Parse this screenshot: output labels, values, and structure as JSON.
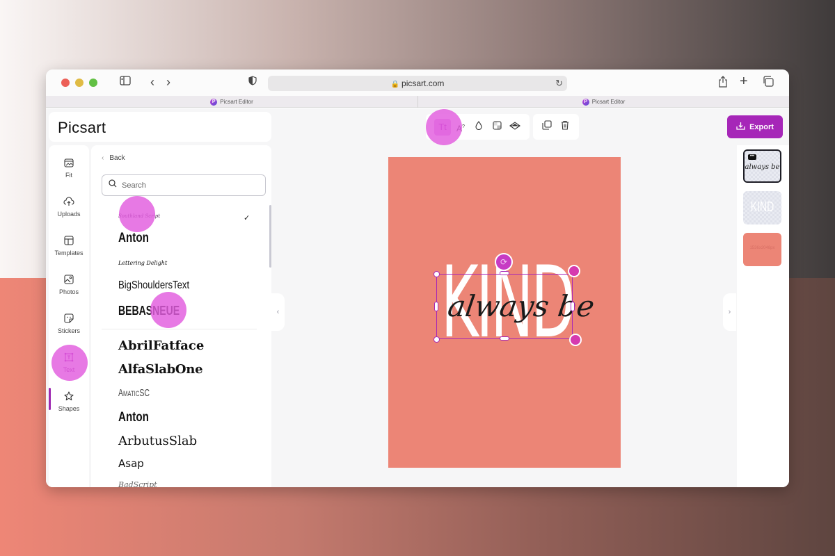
{
  "browser": {
    "url": "picsart.com",
    "tabs": [
      {
        "label": "Picsart Editor"
      },
      {
        "label": "Picsart Editor"
      }
    ],
    "icons": {
      "sidebar": "sidebar-icon",
      "back": "chevron-left-icon",
      "forward": "chevron-right-icon",
      "privacy": "shield-icon",
      "lock": "lock-icon",
      "reload": "reload-icon",
      "share": "share-icon",
      "new_tab": "plus-icon",
      "tabs": "tabs-overview-icon"
    }
  },
  "app": {
    "logo": "Picsart",
    "accent_color": "#a626b8",
    "rail": [
      {
        "label": "Fit",
        "icon": "fit-icon"
      },
      {
        "label": "Uploads",
        "icon": "upload-cloud-icon"
      },
      {
        "label": "Templates",
        "icon": "templates-icon"
      },
      {
        "label": "Photos",
        "icon": "photos-icon"
      },
      {
        "label": "Stickers",
        "icon": "sticker-icon"
      },
      {
        "label": "Text",
        "icon": "text-icon",
        "active": true
      },
      {
        "label": "Shapes",
        "icon": "star-icon"
      }
    ],
    "panel": {
      "back_label": "Back",
      "search_placeholder": "Search",
      "search_value": "",
      "recent_fonts": [
        {
          "label": "Southland Script",
          "selected": true
        },
        {
          "label": "Anton"
        },
        {
          "label": "Lettering Delight"
        },
        {
          "label": "BigShouldersText"
        },
        {
          "label": "BEBASNEUE"
        }
      ],
      "all_fonts": [
        {
          "label": "AbrilFatface"
        },
        {
          "label": "AlfaSlabOne"
        },
        {
          "label": "AmaticSC"
        },
        {
          "label": "Anton"
        },
        {
          "label": "ArbutusSlab"
        },
        {
          "label": "Asap"
        },
        {
          "label": "BadScript"
        }
      ]
    },
    "toolbar": {
      "text_tools": [
        {
          "label": "Tt",
          "name": "font-tool",
          "active": true
        },
        {
          "label": "A",
          "name": "text-style-tool"
        },
        {
          "label": "",
          "name": "color-tool"
        },
        {
          "label": "",
          "name": "opacity-tool"
        },
        {
          "label": "",
          "name": "blend-tool"
        }
      ],
      "actions": [
        {
          "name": "duplicate"
        },
        {
          "name": "delete"
        }
      ]
    },
    "export_label": "Export",
    "canvas": {
      "background_color": "#ec8576",
      "text_kind": "KIND",
      "text_script": "always be"
    },
    "layers": [
      {
        "label": "always be",
        "selected": true
      },
      {
        "label": "KIND"
      },
      {
        "label": "1536x2048px"
      }
    ]
  }
}
